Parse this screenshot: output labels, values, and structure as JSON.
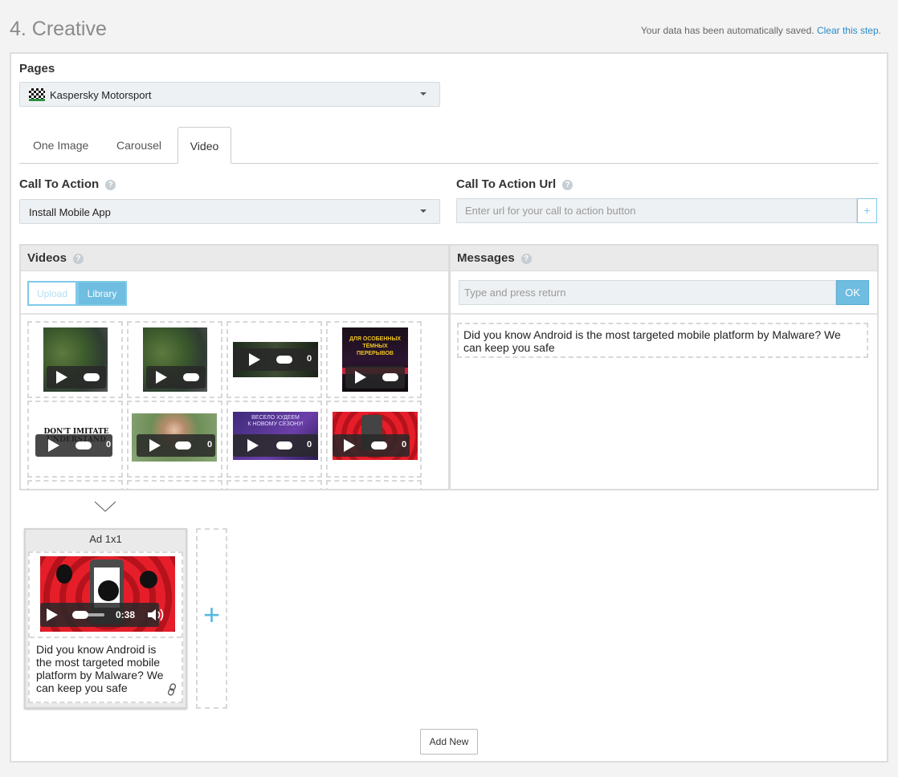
{
  "header": {
    "step_title": "4. Creative",
    "autosave_text": "Your data has been automatically saved.",
    "clear_link": "Clear this step."
  },
  "pages": {
    "label": "Pages",
    "selected": "Kaspersky Motorsport"
  },
  "tabs": [
    {
      "label": "One Image",
      "active": false
    },
    {
      "label": "Carousel",
      "active": false
    },
    {
      "label": "Video",
      "active": true
    }
  ],
  "cta": {
    "label": "Call To Action",
    "selected": "Install Mobile App",
    "help": "?"
  },
  "cta_url": {
    "label": "Call To Action Url",
    "placeholder": "Enter url for your call to action button",
    "add_button": "+",
    "help": "?"
  },
  "videos": {
    "label": "Videos",
    "help": "?",
    "upload_button": "Upload",
    "library_button": "Library",
    "items": [
      {
        "thumb": "aerial-green",
        "time": ""
      },
      {
        "thumb": "aerial-green",
        "time": ""
      },
      {
        "thumb": "dark-green",
        "time": "0"
      },
      {
        "thumb": "poster-dark",
        "time": ""
      },
      {
        "thumb": "text-dont-imitate",
        "time": "0",
        "caption": "DON'T IMITATE\nUNDERSTAND"
      },
      {
        "thumb": "girl-portrait",
        "time": "0"
      },
      {
        "thumb": "purple-promo",
        "time": "0",
        "caption": "ВЕСЕЛО ХУДЕЕМ\nК НОВОМУ СЕЗОНУ!"
      },
      {
        "thumb": "red-malware",
        "time": "0"
      }
    ],
    "poster_caption": "ДЛЯ ОСОБЕННЫХ\nТЁМНЫХ ПЕРЕРЫВОВ"
  },
  "messages": {
    "label": "Messages",
    "help": "?",
    "input_placeholder": "Type and press return",
    "ok_button": "OK",
    "items": [
      "Did you know Android is the most targeted mobile platform by Malware? We can keep you safe"
    ]
  },
  "ad": {
    "title": "Ad 1x1",
    "video_time": "0:38",
    "text": "Did you know Android is the most targeted mobile platform by Malware? We can keep you safe",
    "add_slot": "+"
  },
  "footer": {
    "add_new_button": "Add New"
  },
  "colors": {
    "accent": "#6fbde0",
    "link": "#2a8ac9",
    "malware_red": "#e51e2a"
  },
  "icons": [
    "help-icon",
    "caret-down-icon",
    "play-icon",
    "volume-icon",
    "link-icon",
    "plus-icon",
    "chevron-down-icon",
    "checkered-flag-icon"
  ]
}
